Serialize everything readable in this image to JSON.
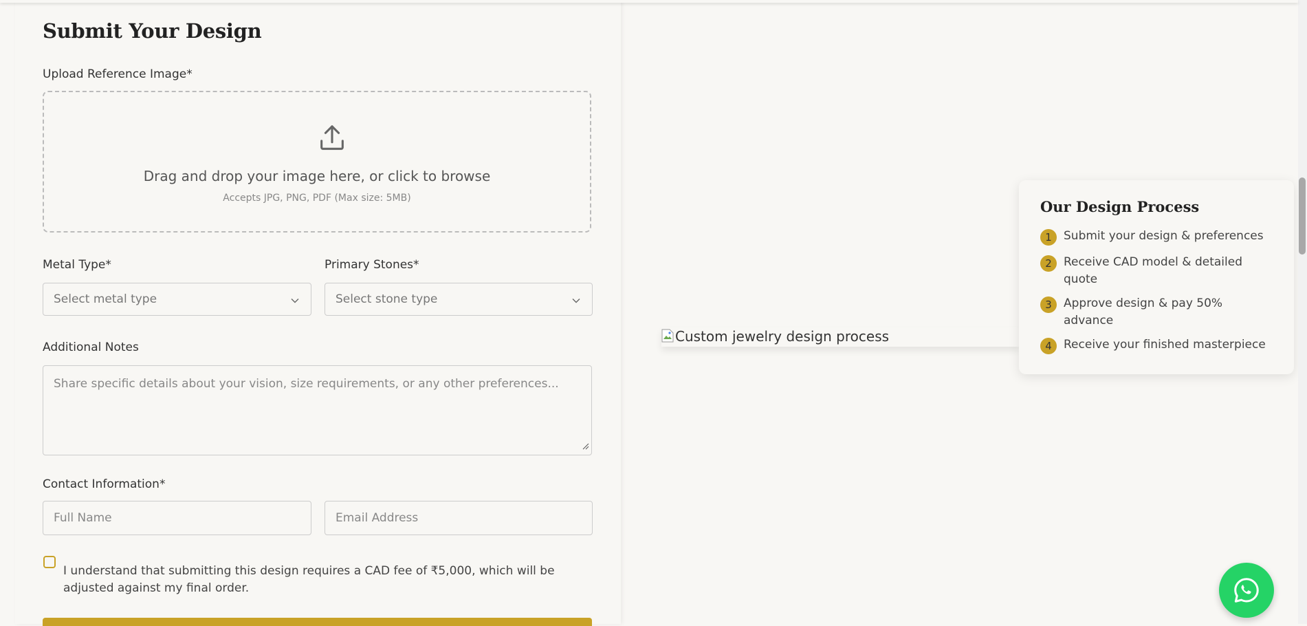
{
  "form": {
    "title": "Submit Your Design",
    "upload_label": "Upload Reference Image*",
    "upload_main": "Drag and drop your image here, or click to browse",
    "upload_hint": "Accepts JPG, PNG, PDF (Max size: 5MB)",
    "metal_label": "Metal Type*",
    "metal_placeholder": "Select metal type",
    "stones_label": "Primary Stones*",
    "stones_placeholder": "Select stone type",
    "notes_label": "Additional Notes",
    "notes_placeholder": "Share specific details about your vision, size requirements, or any other preferences...",
    "contact_label": "Contact Information*",
    "name_placeholder": "Full Name",
    "email_placeholder": "Email Address",
    "consent_text": "I understand that submitting this design requires a CAD fee of ₹5,000, which will be adjusted against my final order."
  },
  "image_alt": "Custom jewelry design process",
  "process": {
    "title": "Our Design Process",
    "steps": [
      {
        "num": "1",
        "text": "Submit your design & preferences"
      },
      {
        "num": "2",
        "text": "Receive CAD model & detailed quote"
      },
      {
        "num": "3",
        "text": "Approve design & pay 50% advance"
      },
      {
        "num": "4",
        "text": "Receive your finished masterpiece"
      }
    ]
  },
  "colors": {
    "accent_gold": "#c9a227",
    "whatsapp_green": "#25d366",
    "page_bg": "#f8f7f4"
  },
  "icons": {
    "upload": "upload-icon",
    "chevron": "chevron-down-icon",
    "whatsapp": "whatsapp-icon"
  }
}
